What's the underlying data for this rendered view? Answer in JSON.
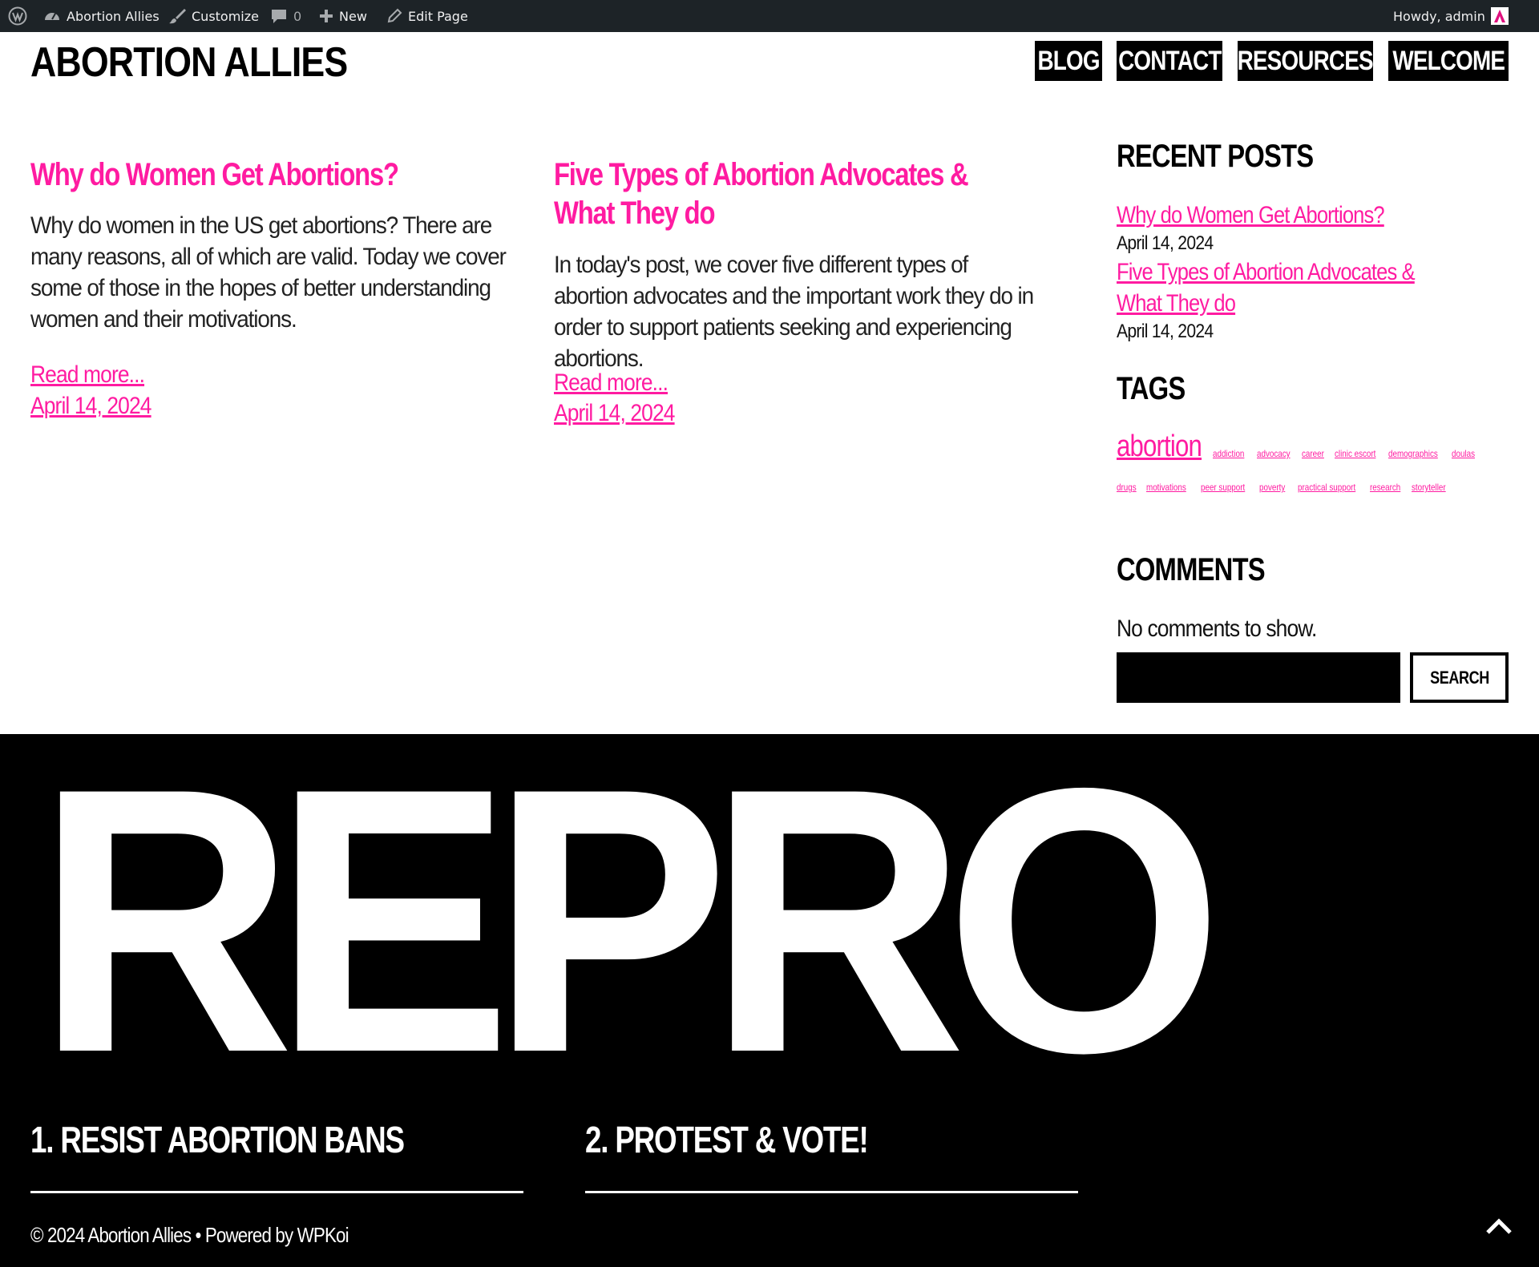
{
  "admin_bar": {
    "site_name": "Abortion Allies",
    "customize": "Customize",
    "comments_count": "0",
    "new": "New",
    "edit_page": "Edit Page",
    "howdy": "Howdy, admin",
    "icons": [
      "wordpress-icon",
      "dashboard-icon",
      "brush-icon",
      "comment-icon",
      "plus-icon",
      "pencil-icon"
    ]
  },
  "header": {
    "site_title": "ABORTION ALLIES",
    "nav": [
      "BLOG",
      "CONTACT",
      "RESOURCES",
      "WELCOME"
    ]
  },
  "posts": [
    {
      "title": "Why do Women Get Abortions?",
      "excerpt": "Why do women in the US get abortions? There are many reasons, all of which are valid. Today we cover some of those in the hopes of better understanding women and their motivations.",
      "read_more": "Read more...",
      "date": "April 14, 2024"
    },
    {
      "title": "Five Types of Abortion Advocates & What They do",
      "excerpt": "In today's post, we cover five different types of abortion advocates and the important work they do in order to support patients seeking and experiencing abortions.",
      "read_more": "Read more...",
      "date": "April 14, 2024"
    }
  ],
  "sidebar": {
    "recent_title": "RECENT POSTS",
    "recent": [
      {
        "title": "Why do Women Get Abortions?",
        "date": "April 14, 2024"
      },
      {
        "title": "Five Types of Abortion Advocates & What They do",
        "date": "April 14, 2024"
      }
    ],
    "tags_title": "TAGS",
    "tags": [
      "abortion",
      "addiction",
      "advocacy",
      "career",
      "clinic escort",
      "demographics",
      "doulas",
      "drugs",
      "motivations",
      "peer support",
      "poverty",
      "practical support",
      "research",
      "storyteller"
    ],
    "comments_title": "COMMENTS",
    "no_comments": "No comments to show.",
    "search_placeholder": "",
    "search_button": "SEARCH"
  },
  "footer": {
    "big_text": "REPRO",
    "heading_1": "1. RESIST ABORTION BANS",
    "heading_2": "2. PROTEST & VOTE!",
    "copyright": "© 2024 Abortion Allies • Powered by WPKoi"
  },
  "colors": {
    "accent": "#ff1ba1",
    "admin_bar": "#1d2327",
    "footer_bg": "#000000"
  }
}
